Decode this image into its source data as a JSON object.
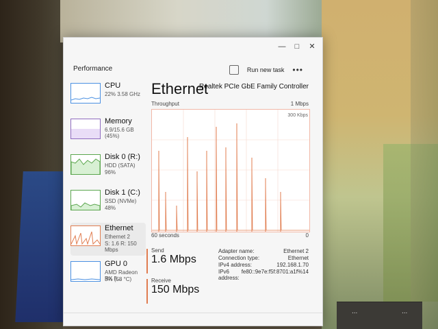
{
  "window": {
    "title": "Performance",
    "controls": [
      "—",
      "□",
      "✕"
    ]
  },
  "toolbar": {
    "run_new_task": "Run new task",
    "more": "•••"
  },
  "sidebar": {
    "items": [
      {
        "label": "CPU",
        "sub": "22%  3.58 GHz"
      },
      {
        "label": "Memory",
        "sub": "6.9/15.6 GB (45%)"
      },
      {
        "label": "Disk 0 (R:)",
        "sub": "HDD (SATA)",
        "sub2": "96%"
      },
      {
        "label": "Disk 1 (C:)",
        "sub": "SSD (NVMe)",
        "sub2": "48%"
      },
      {
        "label": "Ethernet",
        "sub": "Ethernet 2",
        "sub2": "S: 1.6  R: 150 Mbps"
      },
      {
        "label": "GPU 0",
        "sub": "AMD Radeon RX 5...",
        "sub2": "3%  (58 °C)"
      }
    ]
  },
  "main": {
    "title": "Ethernet",
    "adapter": "Realtek PCIe GbE Family Controller",
    "throughput_label": "Throughput",
    "scale_label": "1 Mbps",
    "scale_top": "300 Kbps",
    "time_left": "60 seconds",
    "time_right": "0",
    "send_label": "Send",
    "send_value": "1.6 Mbps",
    "receive_label": "Receive",
    "receive_value": "150 Mbps",
    "details": [
      {
        "k": "Adapter name:",
        "v": "Ethernet 2"
      },
      {
        "k": "Connection type:",
        "v": "Ethernet"
      },
      {
        "k": "IPv4 address:",
        "v": "192.168.1.70"
      },
      {
        "k": "IPv6 address:",
        "v": "fe80::9e7e:f5f:8701:a1f%14"
      }
    ]
  },
  "bottom": {
    "left": "...",
    "right": "..."
  }
}
